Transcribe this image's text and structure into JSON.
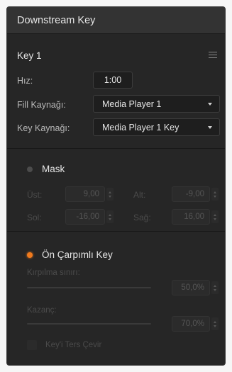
{
  "panel": {
    "title": "Downstream Key"
  },
  "key": {
    "title": "Key 1",
    "rate_label": "Hız:",
    "rate_value": "1:00",
    "fill_label": "Fill Kaynağı:",
    "fill_value": "Media Player 1",
    "key_label": "Key Kaynağı:",
    "key_value": "Media Player 1 Key"
  },
  "mask": {
    "title": "Mask",
    "enabled": false,
    "top_label": "Üst:",
    "top_value": "9,00",
    "bottom_label": "Alt:",
    "bottom_value": "-9,00",
    "left_label": "Sol:",
    "left_value": "-16,00",
    "right_label": "Sağ:",
    "right_value": "16,00"
  },
  "premultiplied": {
    "title": "Ön Çarpımlı Key",
    "enabled": true,
    "clip_label": "Kırpılma sınırı:",
    "clip_value": "50,0%",
    "gain_label": "Kazanç:",
    "gain_value": "70,0%",
    "invert_label": "Key'i Ters Çevir"
  },
  "colors": {
    "accent": "#f07a1d",
    "panel_bg": "#262626",
    "header_bg": "#333333"
  }
}
